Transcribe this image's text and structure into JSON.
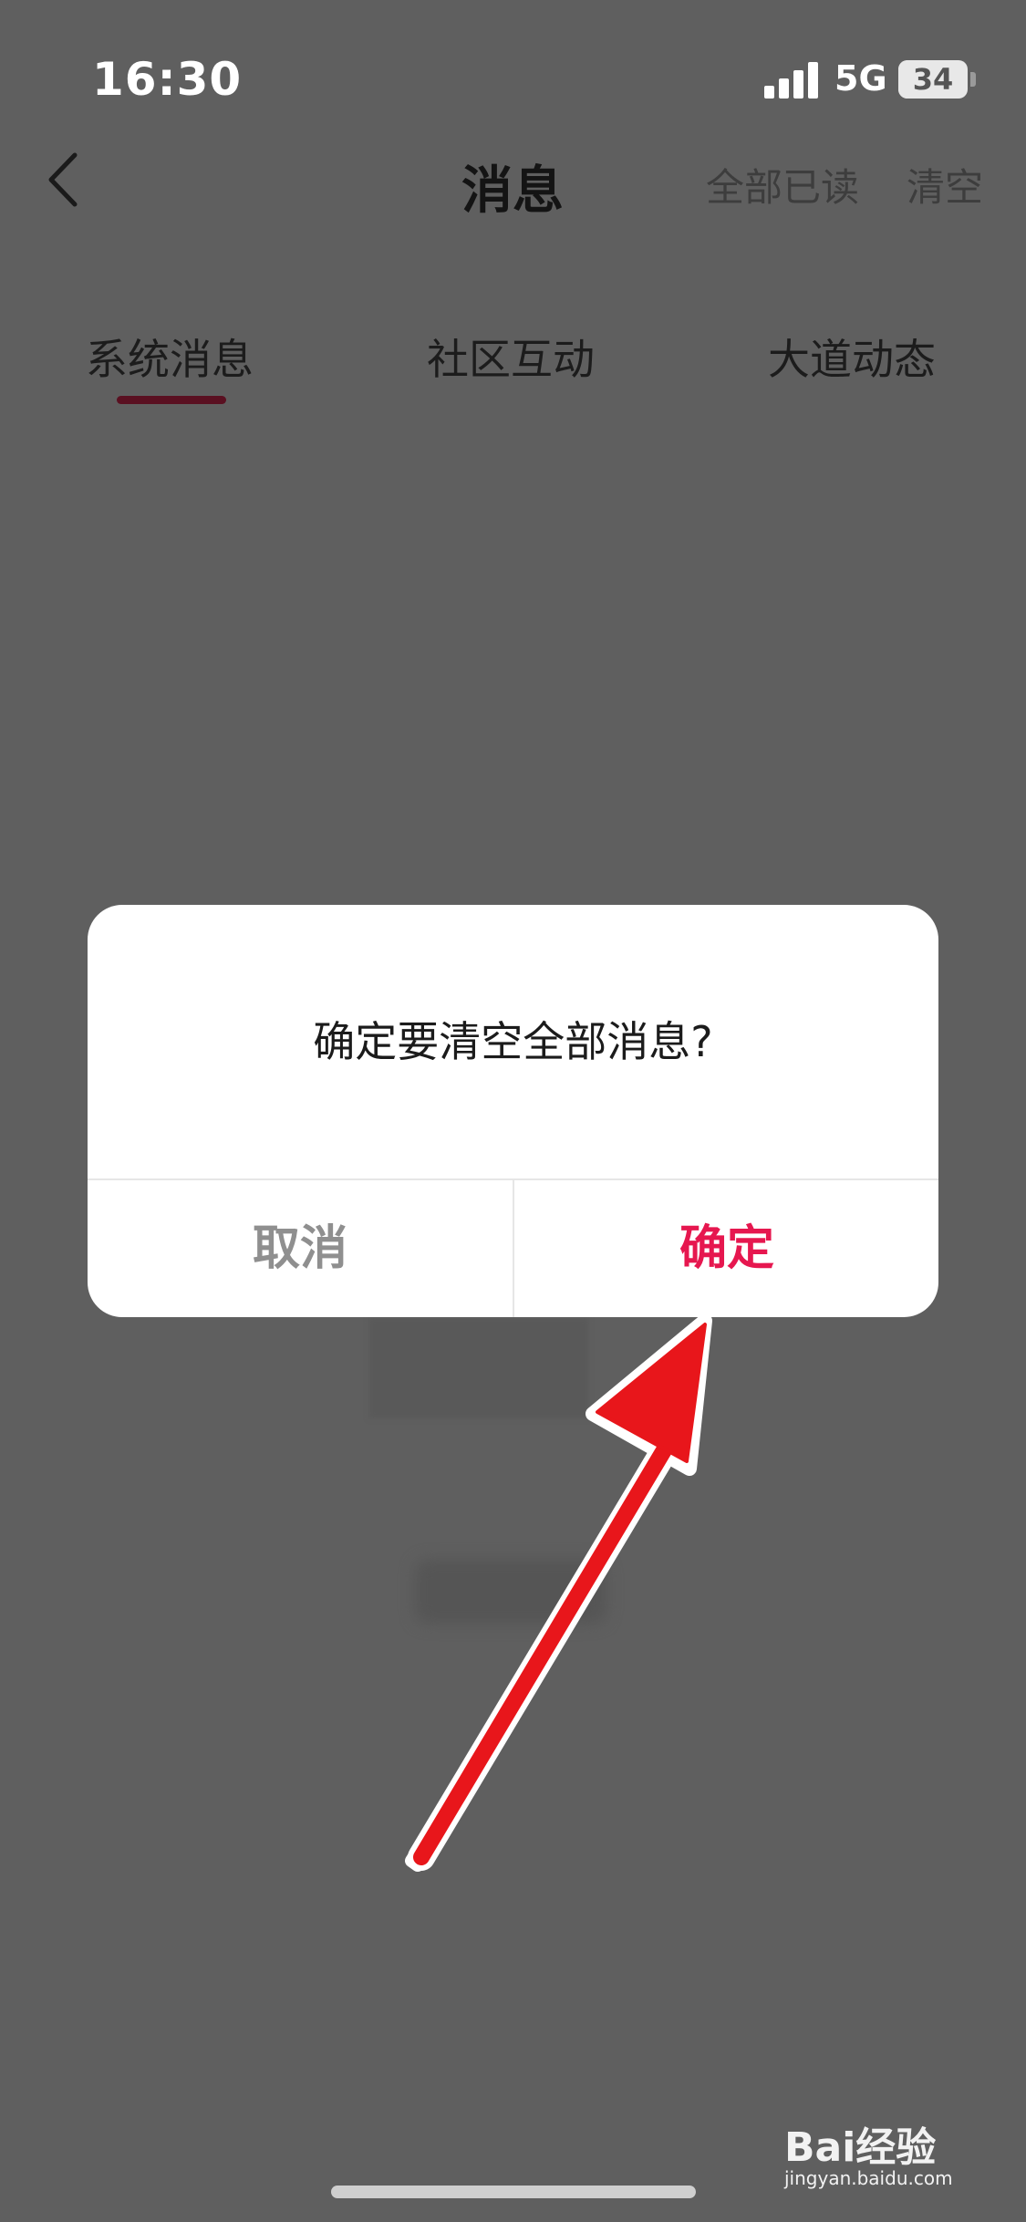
{
  "status_bar": {
    "time": "16:30",
    "network": "5G",
    "battery": "34"
  },
  "nav": {
    "title": "消息",
    "mark_all_read": "全部已读",
    "clear": "清空"
  },
  "tabs": [
    {
      "label": "系统消息",
      "active": true
    },
    {
      "label": "社区互动",
      "active": false
    },
    {
      "label": "大道动态",
      "active": false
    }
  ],
  "dialog": {
    "message": "确定要清空全部消息?",
    "cancel_label": "取消",
    "confirm_label": "确定"
  },
  "watermark": {
    "logo": "Bai经验",
    "site": "jingyan.baidu.com"
  },
  "colors": {
    "overlay_bg": "#5f5f5f",
    "accent_confirm": "#e6174f",
    "tab_indicator": "#5a1021",
    "arrow": "#e8161b"
  },
  "icons": {
    "back": "chevron-left-icon",
    "signal": "signal-bars-icon",
    "battery": "battery-icon",
    "arrow": "red-arrow-annotation"
  }
}
